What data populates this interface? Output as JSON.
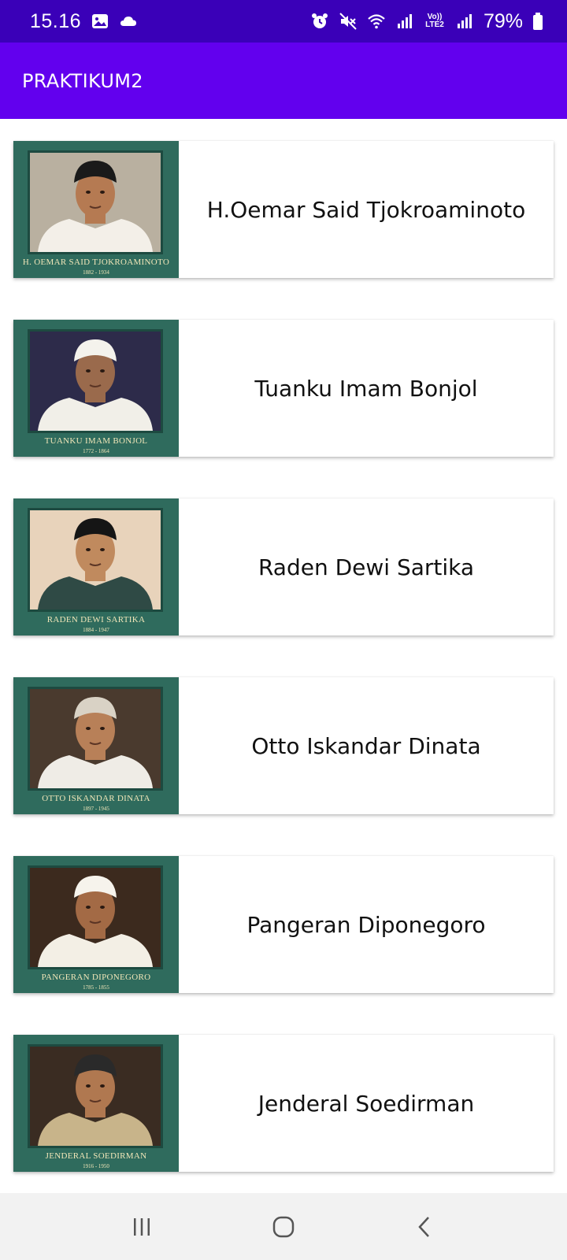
{
  "status_bar": {
    "time": "15.16",
    "battery_percent": "79%",
    "network_label": "Vo)) LTE2",
    "icons": [
      "gallery-icon",
      "cloud-icon",
      "alarm-icon",
      "mute-icon",
      "wifi-icon",
      "signal-icon",
      "signal-icon",
      "battery-icon"
    ]
  },
  "app_bar": {
    "title": "PRAKTIKUM2"
  },
  "heroes": [
    {
      "name": "H.Oemar Said Tjokroaminoto",
      "caption": "H. OEMAR SAID TJOKROAMINOTO",
      "years": "1882 - 1934",
      "portrait_bg": "#b9b0a0",
      "skin": "#b57a52",
      "cloth": "#f3efe8",
      "hat": "#1a1a1a"
    },
    {
      "name": "Tuanku Imam Bonjol",
      "caption": "TUANKU IMAM BONJOL",
      "years": "1772 - 1864",
      "portrait_bg": "#2d2b4a",
      "skin": "#9a6a4c",
      "cloth": "#f1efe8",
      "hat": "#f4f2ec"
    },
    {
      "name": "Raden Dewi Sartika",
      "caption": "RADEN DEWI SARTIKA",
      "years": "1884 - 1947",
      "portrait_bg": "#e8d3bb",
      "skin": "#c08a5e",
      "cloth": "#2f4a45",
      "hat": "#151515"
    },
    {
      "name": "Otto Iskandar Dinata",
      "caption": "OTTO ISKANDAR DINATA",
      "years": "1897 - 1945",
      "portrait_bg": "#4a3a2e",
      "skin": "#b88058",
      "cloth": "#efece6",
      "hat": "#d9d2c5"
    },
    {
      "name": "Pangeran Diponegoro",
      "caption": "PANGERAN DIPONEGORO",
      "years": "1785 - 1855",
      "portrait_bg": "#3c2a1e",
      "skin": "#a36a45",
      "cloth": "#f3efe5",
      "hat": "#f6f3ec"
    },
    {
      "name": "Jenderal Soedirman",
      "caption": "JENDERAL SOEDIRMAN",
      "years": "1916 - 1950",
      "portrait_bg": "#3a2c22",
      "skin": "#b07850",
      "cloth": "#c8b48a",
      "hat": "#2a2a2a"
    }
  ],
  "nav_bar": {
    "buttons": [
      "recent-apps-icon",
      "home-icon",
      "back-icon"
    ]
  }
}
